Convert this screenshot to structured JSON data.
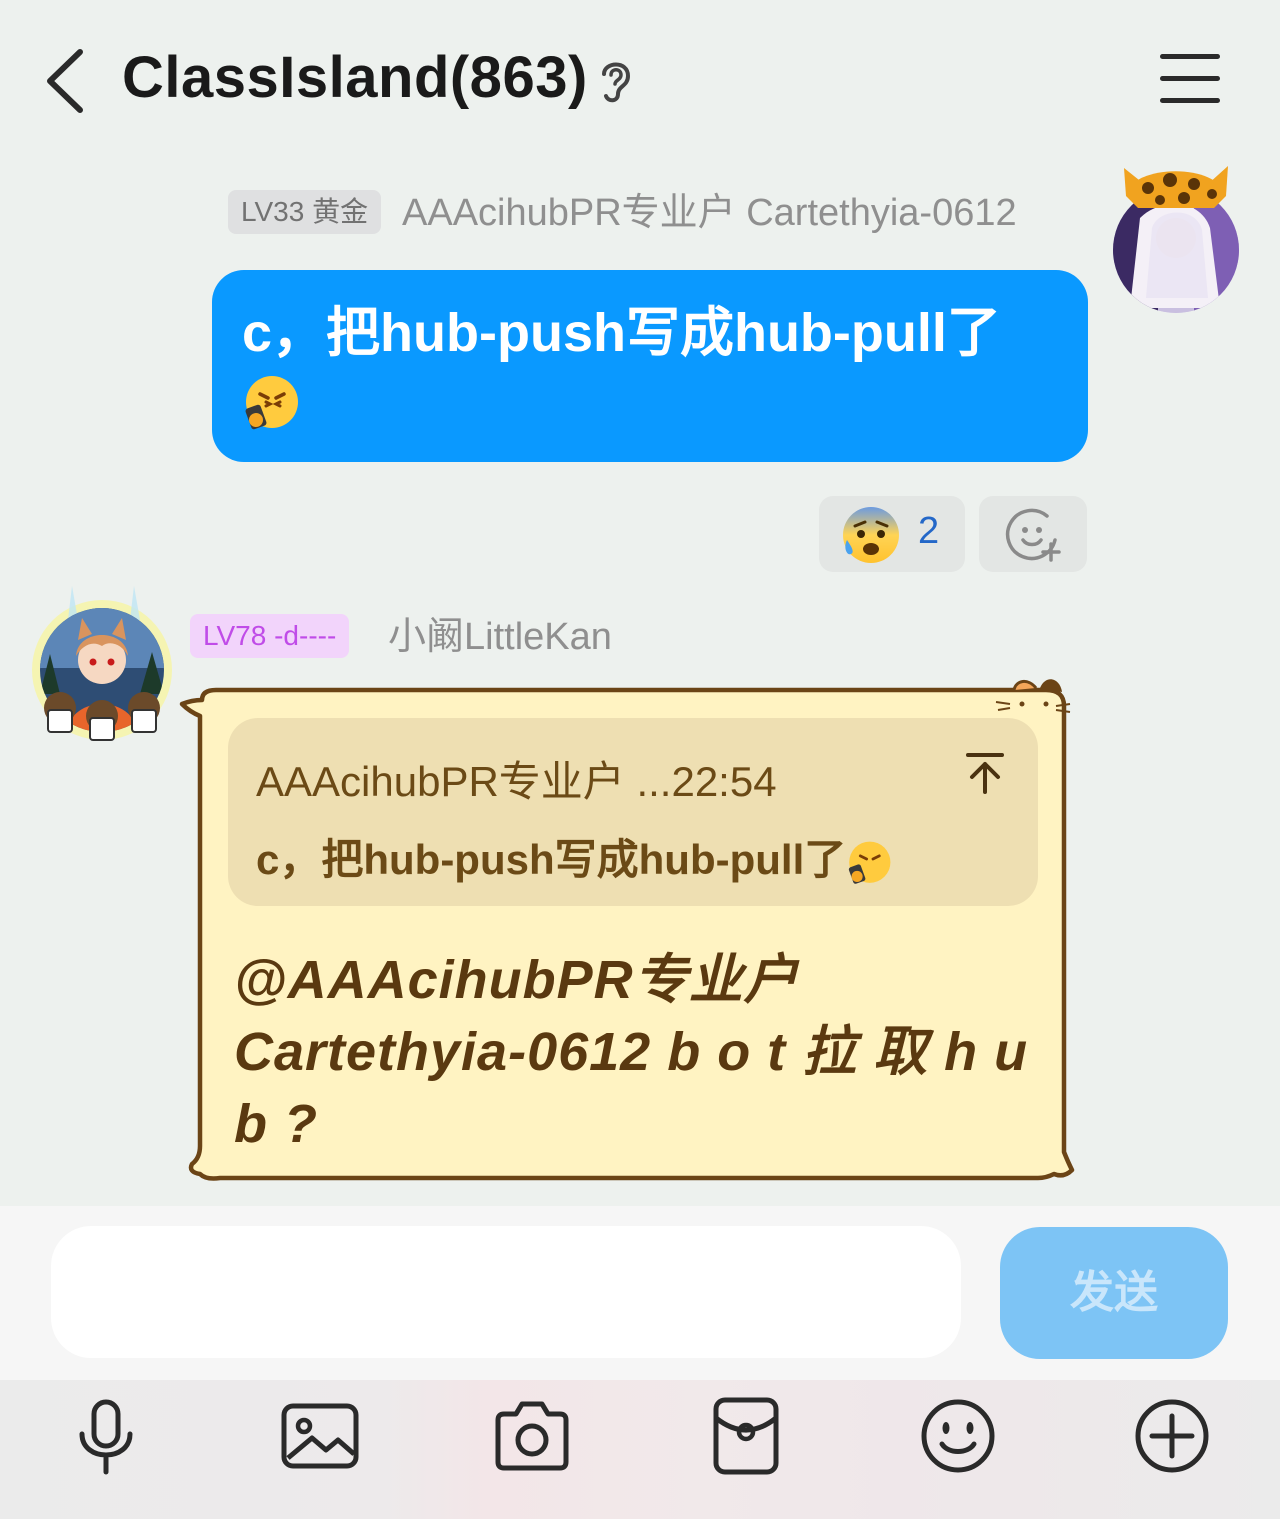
{
  "header": {
    "title": "ClassIsland(863)",
    "icons": [
      "back-arrow-icon",
      "ear-icon",
      "hamburger-menu-icon"
    ]
  },
  "messages": [
    {
      "badge": "LV33 黄金",
      "sender": "AAAcihubPR专业户 Cartethyia-0612",
      "text": "c，把hub-push写成hub-pull了",
      "emoji": "face-with-phone-emoji",
      "reaction": {
        "emoji": "anxious-face-with-sweat",
        "count": "2"
      }
    },
    {
      "badge": "LV78 -d----",
      "sender": "小阚LittleKan",
      "quote": {
        "header": "AAAcihubPR专业户 ...22:54",
        "text": "c，把hub-push写成hub-pull了"
      },
      "text": "@AAAcihubPR专业户 Cartethyia-0612 b o t 拉 取 h u b ?"
    }
  ],
  "input": {
    "value": "",
    "send_label": "发送"
  },
  "toolbar": {
    "icons": [
      "microphone-icon",
      "image-icon",
      "camera-icon",
      "red-packet-icon",
      "smiley-icon",
      "plus-circle-icon"
    ]
  },
  "colors": {
    "accent": "#0A99FF",
    "send_disabled": "#7DC4F5",
    "bubble_yellow": "#FFF3C2",
    "bubble_border": "#6b4416"
  }
}
